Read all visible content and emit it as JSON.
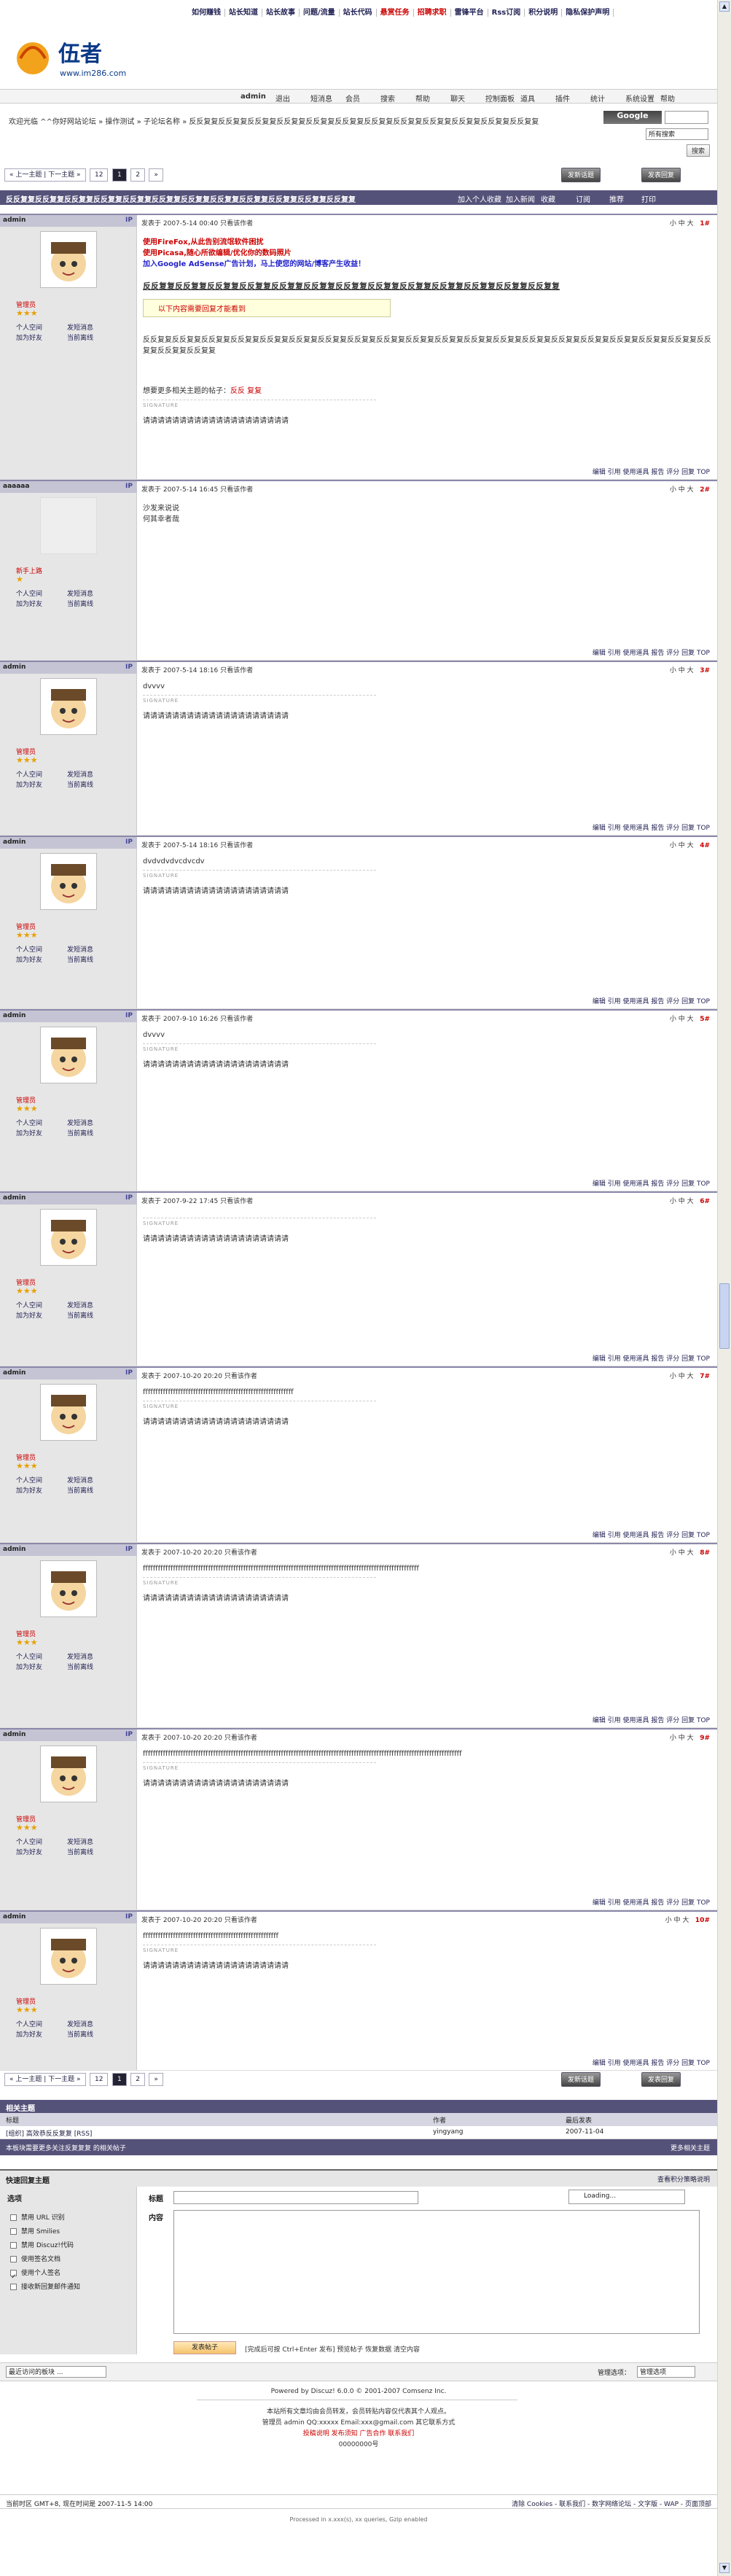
{
  "toplinks": [
    "如何赚钱",
    "站长知道",
    "站长故事",
    "问题/流量",
    "站长代码",
    "悬赏任务",
    "招聘求职",
    "雷锋平台",
    "Rss订阅",
    "积分说明",
    "隐私保护声明"
  ],
  "logo": {
    "brand": "伍者",
    "url": "www.im286.com"
  },
  "nav": {
    "user": "admin",
    "items": [
      "退出",
      "短消息",
      "会员",
      "搜索",
      "帮助",
      "聊天",
      "控制面板",
      "道具",
      "插件",
      "统计",
      "系统设置",
      "帮助"
    ]
  },
  "crumb": "欢迎光临 ^^你好网站论坛 » 操作测试 » 子论坛名称 » 反反复复反反复复反反复复反反复复反反复复反反复复反反复复反反复复反反复复反反复复反反复复反反复复",
  "search": {
    "select": "所有搜索",
    "btn": "搜索"
  },
  "pager": {
    "prev": "« 上一主题 | 下一主题 »",
    "pages": [
      "12",
      "1",
      "2",
      "»"
    ]
  },
  "buttons": {
    "new_thread": "发新话题",
    "reply": "发表回复"
  },
  "thread": {
    "title": "反反复复反反复复反反复复反反复复反反复复反反复复反反复复反反复复反反复复反反复复反反复复反反复复",
    "links": [
      "加入个人收藏",
      "加入新闻",
      "收藏",
      "订阅",
      "推荐",
      "打印"
    ]
  },
  "posts": [
    {
      "user": "admin",
      "floor": "1",
      "time": "发表于 2007-5-14 00:40",
      "rank": "管理员",
      "sig": "SIGNATURE",
      "sigtext": "请请请请请请请请请请请请请请请请请请请请",
      "ad1": "使用FireFox,从此告别流氓软件困扰",
      "ad2": "使用Picasa,随心所欲编辑/优化你的数码照片",
      "ad3": "加入Google AdSense广告计划，马上使您的网站/博客产生收益！",
      "big": "反反复复反反复复反反复复反反复复反反复复反反复复反反复复反反复复反反复复反反复复反反复复反反复复反反复复",
      "notice": "以下内容需要回复才能看到",
      "body": "反反复复反反复复反反复复反反复复反反复复反反复复反反复复反反复复反反复复反反复复反反复复反反复复反反复复反反复复反反复复反反复复反反复复反反复复反反复复反反复复反反复复反反复复",
      "more": "想要更多相关主题的帖子：",
      "tags": "反反 复复"
    },
    {
      "user": "aaaaaa",
      "floor": "2",
      "time": "发表于 2007-5-14 16:45",
      "rank": "新手上路",
      "body": "沙发来说说",
      "body2": "何其幸者哉",
      "sig": "",
      "sigtext": ""
    },
    {
      "user": "admin",
      "floor": "3",
      "time": "发表于 2007-5-14 18:16",
      "rank": "管理员",
      "body": "dvvvv",
      "sig": "SIGNATURE",
      "sigtext": "请请请请请请请请请请请请请请请请请请请请"
    },
    {
      "user": "admin",
      "floor": "4",
      "time": "发表于 2007-5-14 18:16",
      "rank": "管理员",
      "body": "dvdvdvdvcdvcdv",
      "sig": "SIGNATURE",
      "sigtext": "请请请请请请请请请请请请请请请请请请请请"
    },
    {
      "user": "admin",
      "floor": "5",
      "time": "发表于 2007-9-10 16:26",
      "rank": "管理员",
      "body": "dvvvv",
      "sig": "SIGNATURE",
      "sigtext": "请请请请请请请请请请请请请请请请请请请请"
    },
    {
      "user": "admin",
      "floor": "6",
      "time": "发表于 2007-9-22 17:45",
      "rank": "管理员",
      "body": "",
      "sig": "SIGNATURE",
      "sigtext": "请请请请请请请请请请请请请请请请请请请请"
    },
    {
      "user": "admin",
      "floor": "7",
      "time": "发表于 2007-10-20 20:20",
      "rank": "管理员",
      "body": "ffffffffffffffffffffffffffffffffffffffffffffffffffffffffffff",
      "sig": "SIGNATURE",
      "sigtext": "请请请请请请请请请请请请请请请请请请请请"
    },
    {
      "user": "admin",
      "floor": "8",
      "time": "发表于 2007-10-20 20:20",
      "rank": "管理员",
      "body": "ffffffffffffffffffffffffffffffffffffffffffffffffffffffffffffffffffffffffffffffffffffffffffffffffffffffffffffff",
      "sig": "SIGNATURE",
      "sigtext": "请请请请请请请请请请请请请请请请请请请请"
    },
    {
      "user": "admin",
      "floor": "9",
      "time": "发表于 2007-10-20 20:20",
      "rank": "管理员",
      "body": "fffffffffffffffffffffffffffffffffffffffffffffffffffffffffffffffffffffffffffffffffffffffffffffffffffffffffffffffffffffffffffffff",
      "sig": "SIGNATURE",
      "sigtext": "请请请请请请请请请请请请请请请请请请请请"
    },
    {
      "user": "admin",
      "floor": "10",
      "time": "发表于 2007-10-20 20:20",
      "rank": "管理员",
      "body": "ffffffffffffffffffffffffffffffffffffffffffffffffffffff",
      "sig": "SIGNATURE",
      "sigtext": "请请请请请请请请请请请请请请请请请请请请"
    }
  ],
  "postlabels": {
    "view_author": "只看该作者",
    "font": "小 中 大",
    "foot": "编辑 引用 使用道具 报告 评分 回复 TOP"
  },
  "user_links": {
    "profile": "个人空间",
    "msg": "发短消息",
    "friend": "加为好友",
    "online": "当前离线"
  },
  "related": {
    "title": "相关主题",
    "cols": [
      "标题",
      "作者",
      "最后发表"
    ],
    "row": [
      "[组织] 高效恭反反复复 [RSS]",
      "yingyang",
      "2007-11-04"
    ],
    "note": "本板块需要更多关注反复复复 的相关帖子",
    "more": "更多相关主题"
  },
  "quick": {
    "title": "快速回复主题",
    "link": "查看积分策略说明",
    "opts_title": "选项",
    "opts": [
      "禁用 URL 识别",
      "禁用 Smilies",
      "禁用 Discuz!代码",
      "使用签名文档",
      "使用个人签名",
      "接收新回复邮件通知"
    ],
    "subject": "标题",
    "content": "内容",
    "loading": "Loading...",
    "submit": "发表帖子",
    "hint": "[完成后可按 Ctrl+Enter 发布] 预览帖子 恢复数据 清空内容"
  },
  "jump": {
    "select": "最近访问的板块 ...",
    "label": "管理选项：",
    "admin": "管理选项"
  },
  "footer": {
    "powered": "Powered by Discuz! 6.0.0 © 2001-2007 Comsenz Inc.",
    "l1": "本站所有文章均由会员转发，会员转贴内容仅代表其个人观点。",
    "l2": "管理员 admin QQ:xxxxx Email:xxx@gmail.com 其它联系方式",
    "l3": "投稿说明 发布须知 广告合作 联系我们",
    "l4": "00000000号",
    "l5": "清除 Cookies - 联系我们 - 数字网络论坛 - 文字版 - WAP - 页面顶部",
    "time": "当前时区 GMT+8, 现在时间是 2007-11-5 14:00",
    "bottom": "Processed in x.xxx(s), xx queries, Gzip enabled"
  }
}
